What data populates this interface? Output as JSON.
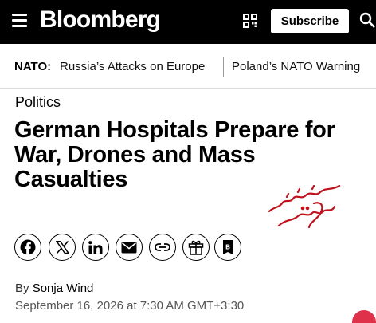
{
  "header": {
    "brand": "Bloomberg",
    "subscribe_label": "Subscribe",
    "menu_icon": "hamburger-menu-icon",
    "qr_icon": "qr-code-icon",
    "search_icon": "search-icon",
    "background": "#000000"
  },
  "subnav": {
    "label": "NATO:",
    "items": [
      {
        "label": "Russia’s Attacks on Europe"
      },
      {
        "label": "Poland’s NATO Warning"
      }
    ]
  },
  "article": {
    "category": "Politics",
    "headline": "German Hospitals Prepare for War, Drones and Mass Casualties",
    "byline_prefix": "By",
    "author": "Sonja Wind",
    "dateline": "September 16, 2026 at 7:30 AM GMT+3:30"
  },
  "share": {
    "buttons": [
      {
        "name": "facebook-icon"
      },
      {
        "name": "x-icon"
      },
      {
        "name": "linkedin-icon"
      },
      {
        "name": "email-icon"
      },
      {
        "name": "link-icon"
      },
      {
        "name": "gift-icon"
      },
      {
        "name": "bookmark-icon"
      }
    ]
  },
  "watermark": {
    "text": "مستضعفين تاوي",
    "color": "#c0121c"
  },
  "colors": {
    "accent_badge": "#e0314b"
  }
}
